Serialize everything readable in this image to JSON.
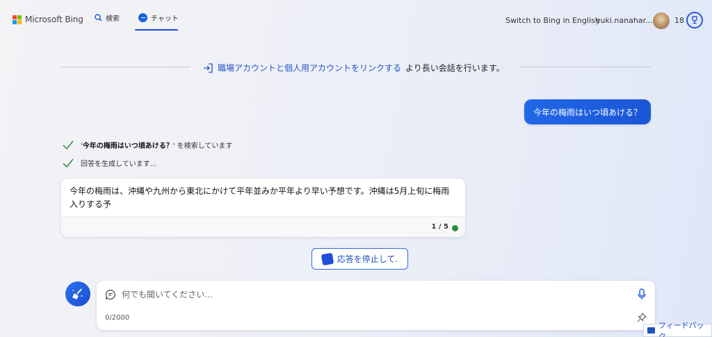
{
  "header": {
    "logo_text": "Microsoft Bing",
    "nav_search": "検索",
    "nav_chat": "チャット",
    "switch_language": "Switch to Bing in English",
    "username": "yuki.nanahar...",
    "rewards_count": "18"
  },
  "banner": {
    "link_text": "職場アカウントと個人用アカウントをリンクする",
    "rest_text": "より長い会話を行います。"
  },
  "conversation": {
    "user_message": "今年の梅雨はいつ頃あける？",
    "progress": [
      {
        "prefix": "'",
        "query": "今年の梅雨はいつ頃あける？",
        "suffix": "' を検索しています"
      },
      {
        "text": "回答を生成しています..."
      }
    ],
    "answer_text": "今年の梅雨は、沖縄や九州から東北にかけて平年並みか平年より早い予想です。沖縄は5月上旬に梅雨入りする予",
    "page_counter": "1 / 5"
  },
  "stop_button_label": "応答を停止して.",
  "input": {
    "placeholder": "何でも聞いてください...",
    "char_count": "0/2000"
  },
  "feedback_label": "フィードバック",
  "colors": {
    "accent": "#1b5fe0",
    "user_bubble": "#2167e8",
    "check": "#2e8b3d",
    "link": "#2152c9"
  }
}
